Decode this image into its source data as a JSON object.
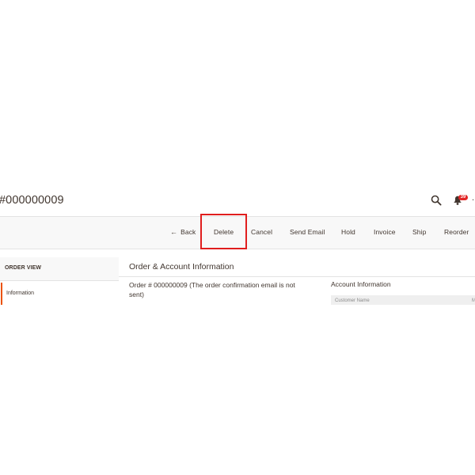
{
  "header": {
    "title": "#000000009",
    "notification_count": "39",
    "user_initial": "."
  },
  "actions": {
    "back": "Back",
    "delete": "Delete",
    "cancel": "Cancel",
    "send_email": "Send Email",
    "hold": "Hold",
    "invoice": "Invoice",
    "ship": "Ship",
    "reorder": "Reorder"
  },
  "sidebar": {
    "heading": "ORDER VIEW",
    "items": [
      {
        "label": "Information"
      }
    ]
  },
  "main": {
    "section_title": "Order & Account Information",
    "order_heading": "Order # 000000009 (The order confirmation email is not sent)",
    "account_heading": "Account Information",
    "account_columns": [
      "Customer Name",
      "M"
    ]
  },
  "colors": {
    "accent": "#eb5202",
    "highlight": "#e01e1e",
    "badge": "#e22626"
  },
  "icons": {
    "search": "search-icon",
    "notifications": "bell-icon",
    "back": "arrow-left-icon"
  }
}
